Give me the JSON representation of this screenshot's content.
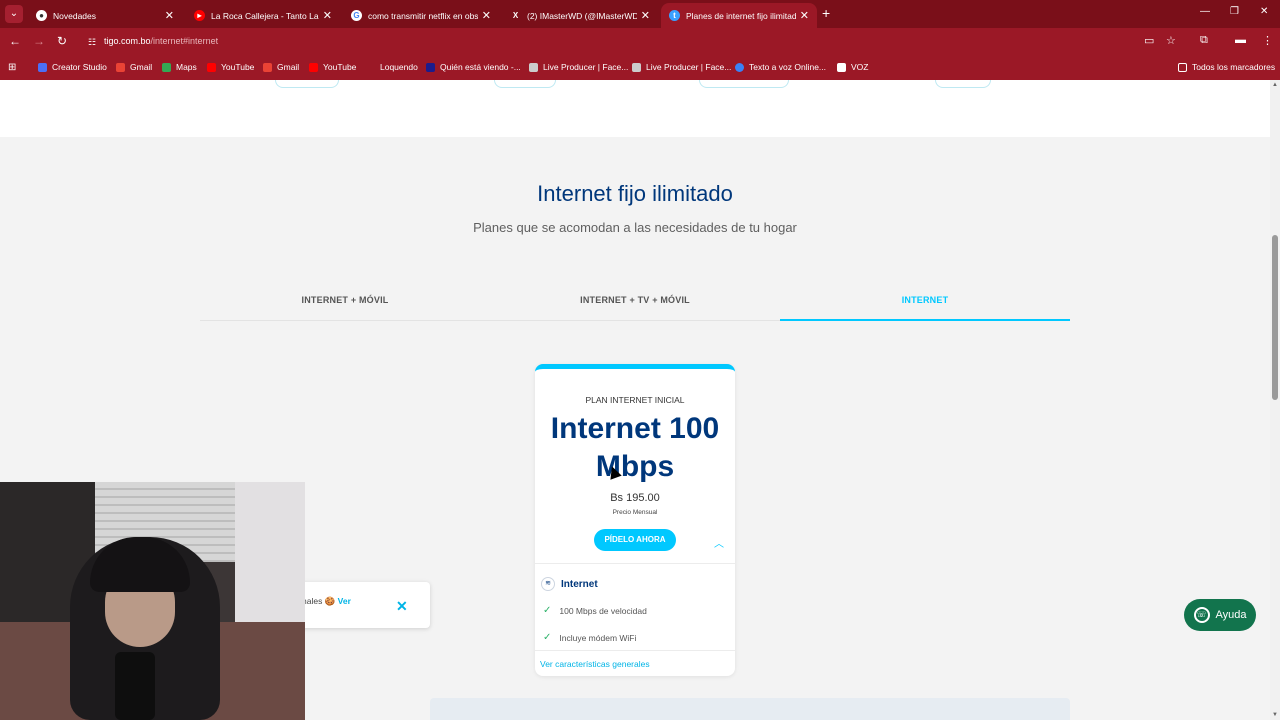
{
  "browser": {
    "tabs": [
      {
        "title": "Novedades",
        "active": false
      },
      {
        "title": "La Roca Callejera - Tanto La Qu",
        "active": false
      },
      {
        "title": "como transmitir netflix en obs",
        "active": false
      },
      {
        "title": "(2) IMasterWD (@IMasterWD) /",
        "active": false
      },
      {
        "title": "Planes de internet fijo ilimitado",
        "active": true
      }
    ],
    "url_host": "tigo.com.bo",
    "url_path": "/internet#internet",
    "bookmarks": [
      {
        "label": "Creator Studio",
        "color": "#4c6ef5"
      },
      {
        "label": "Gmail",
        "color": "#ea4335"
      },
      {
        "label": "Maps",
        "color": "#34a853"
      },
      {
        "label": "YouTube",
        "color": "#ff0000"
      },
      {
        "label": "Gmail",
        "color": "#ea4335"
      },
      {
        "label": "YouTube",
        "color": "#ff0000"
      },
      {
        "label": "Loquendo",
        "color": "#9b1826"
      },
      {
        "label": "Quién está viendo -...",
        "color": "#1c1c8c"
      },
      {
        "label": "Live Producer | Face...",
        "color": "#cccccc"
      },
      {
        "label": "Live Producer | Face...",
        "color": "#cccccc"
      },
      {
        "label": "Texto a voz Online...",
        "color": "#3b82f6"
      },
      {
        "label": "VOZ",
        "color": "#ffffff"
      }
    ],
    "bookmarks_folder": "Todos los marcadores"
  },
  "section": {
    "title": "Internet fijo ilimitado",
    "subtitle": "Planes que se acomodan a las necesidades de tu hogar"
  },
  "plan_tabs": [
    {
      "label": "INTERNET + MÓVIL",
      "active": false
    },
    {
      "label": "INTERNET + TV + MÓVIL",
      "active": false
    },
    {
      "label": "INTERNET",
      "active": true
    }
  ],
  "plan_card": {
    "eyebrow": "PLAN INTERNET INICIAL",
    "speed_line1": "Internet 100",
    "speed_line2": "Mbps",
    "price": "Bs 195.00",
    "price_label": "Precio Mensual",
    "cta": "PÍDELO AHORA",
    "features_heading": "Internet",
    "features": [
      "100 Mbps de velocidad",
      "Incluye módem WiFi"
    ],
    "more_link": "Ver características generales"
  },
  "toast": {
    "text": "nales 🍪",
    "link": "Ver"
  },
  "help_button": "Ayuda",
  "colors": {
    "accent": "#00c8ff",
    "brand_navy": "#00377b",
    "chrome": "#9b1826",
    "whatsapp": "#12744d"
  }
}
